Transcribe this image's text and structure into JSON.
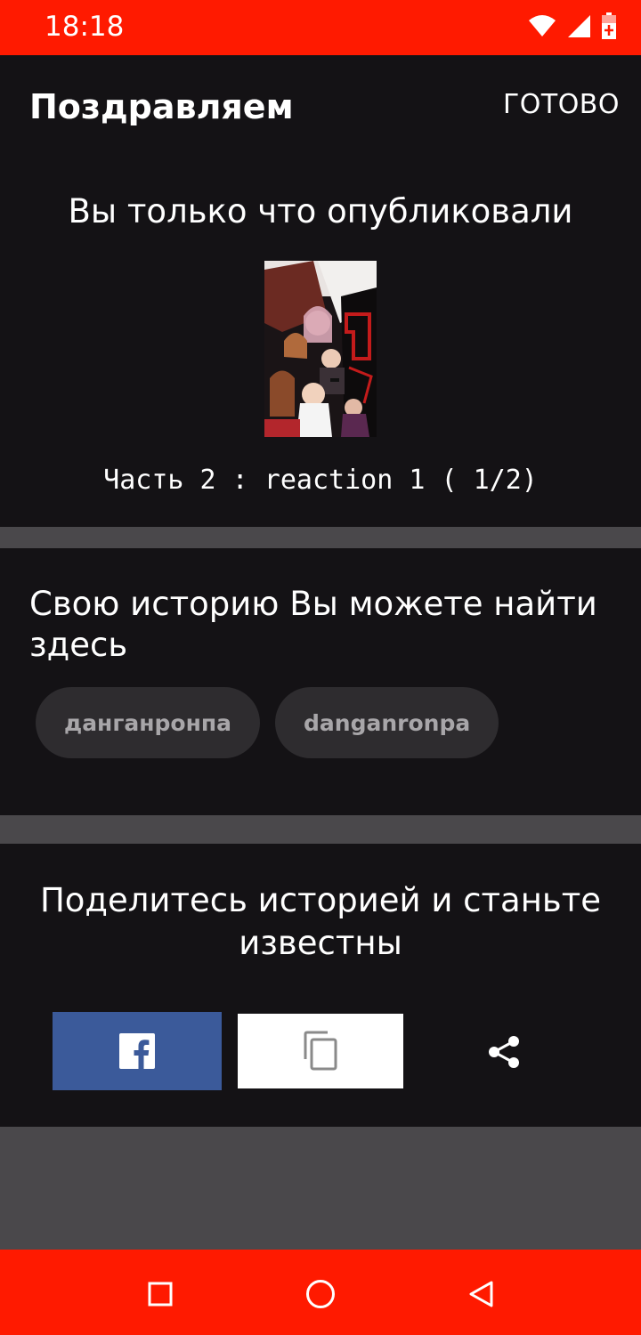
{
  "status_bar": {
    "time": "18:18",
    "icons": [
      "wifi-icon",
      "signal-icon",
      "battery-charging-icon"
    ],
    "color": "#ff1a00"
  },
  "app_bar": {
    "title": "Поздравляем",
    "done_label": "ГОТОВО"
  },
  "published": {
    "heading": "Вы только что опубликовали",
    "chapter_title": "Часть 2 : reaction 1 ( 1/2)"
  },
  "find": {
    "heading": "Свою историю Вы можете найти здесь",
    "tags": [
      "данганронпа",
      "danganronpa"
    ]
  },
  "share": {
    "heading": "Поделитесь историей и станьте известны",
    "buttons": [
      "facebook-icon",
      "copy-link-icon",
      "share-icon"
    ],
    "facebook_color": "#3b5a9a"
  },
  "nav_bar": {
    "buttons": [
      "recents-square-icon",
      "home-circle-icon",
      "back-triangle-icon"
    ]
  }
}
